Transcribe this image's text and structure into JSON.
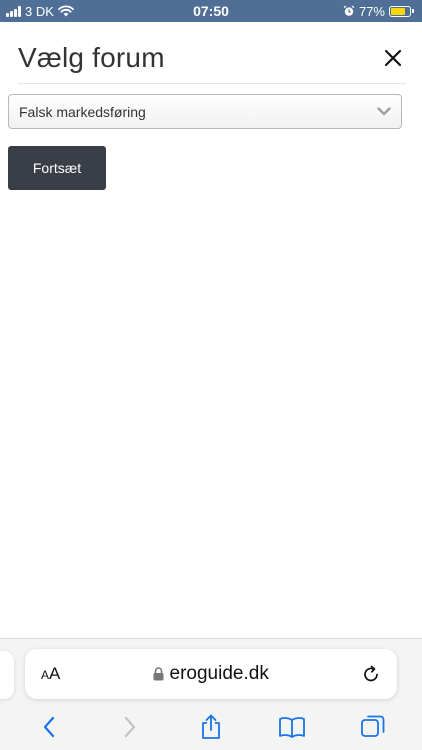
{
  "status_bar": {
    "carrier": "3 DK",
    "time": "07:50",
    "battery": "77%",
    "battery_level": 0.77,
    "icons": [
      "signal-icon",
      "wifi-icon",
      "alarm-icon",
      "battery-icon"
    ]
  },
  "header": {
    "title": "Vælg forum",
    "close_icon": "close-icon"
  },
  "form": {
    "forum_select": {
      "selected": "Falsk markedsføring",
      "icon": "chevron-down-icon"
    },
    "continue_label": "Fortsæt"
  },
  "browser": {
    "text_size_small": "A",
    "text_size_large": "A",
    "url": "eroguide.dk",
    "icons": [
      "lock-icon",
      "reload-icon",
      "back-icon",
      "forward-icon",
      "share-icon",
      "bookmarks-icon",
      "tabs-icon"
    ]
  },
  "colors": {
    "status_bar": "#4f6f96",
    "button": "#3a3f47",
    "ios_blue": "#1a73e8",
    "battery": "#ffd60a"
  }
}
